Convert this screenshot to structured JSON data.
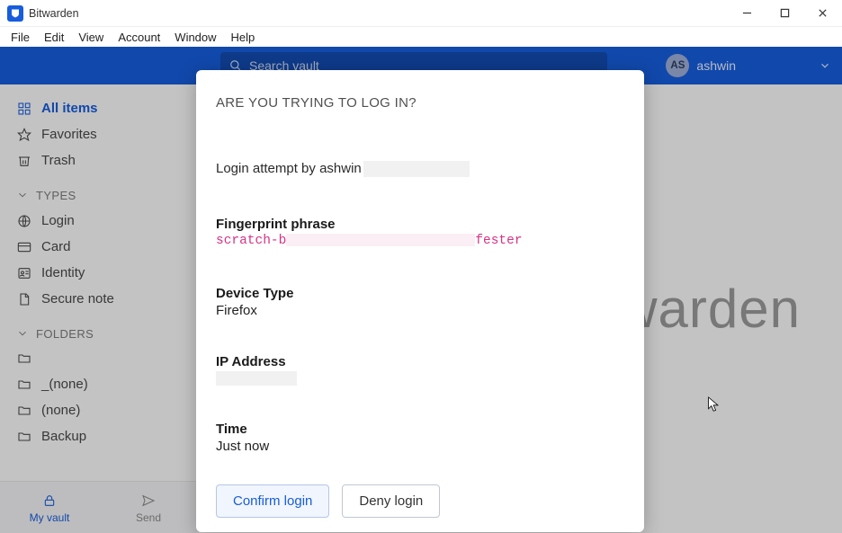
{
  "titlebar": {
    "app_name": "Bitwarden"
  },
  "menubar": [
    "File",
    "Edit",
    "View",
    "Account",
    "Window",
    "Help"
  ],
  "search": {
    "placeholder": "Search vault"
  },
  "account": {
    "initials": "AS",
    "name": "ashwin"
  },
  "sidebar": {
    "main_items": [
      {
        "label": "All items",
        "icon": "grid-icon"
      },
      {
        "label": "Favorites",
        "icon": "star-icon"
      },
      {
        "label": "Trash",
        "icon": "trash-icon"
      }
    ],
    "types_header": "TYPES",
    "types": [
      {
        "label": "Login",
        "icon": "globe-icon"
      },
      {
        "label": "Card",
        "icon": "card-icon"
      },
      {
        "label": "Identity",
        "icon": "identity-icon"
      },
      {
        "label": "Secure note",
        "icon": "note-icon"
      }
    ],
    "folders_header": "FOLDERS",
    "folders": [
      {
        "label": ""
      },
      {
        "label": "_(none)"
      },
      {
        "label": "(none)"
      },
      {
        "label": "Backup"
      }
    ]
  },
  "bottom_tabs": {
    "vault": "My vault",
    "send": "Send"
  },
  "brand_bg": "warden",
  "modal": {
    "title": "ARE YOU TRYING TO LOG IN?",
    "attempt_prefix": "Login attempt by ",
    "attempt_user": "ashwin",
    "fingerprint_label": "Fingerprint phrase",
    "fingerprint_prefix": "scratch-b",
    "fingerprint_suffix": "fester",
    "device_label": "Device Type",
    "device_value": "Firefox",
    "ip_label": "IP Address",
    "ip_value": "",
    "time_label": "Time",
    "time_value": "Just now",
    "confirm": "Confirm login",
    "deny": "Deny login"
  }
}
